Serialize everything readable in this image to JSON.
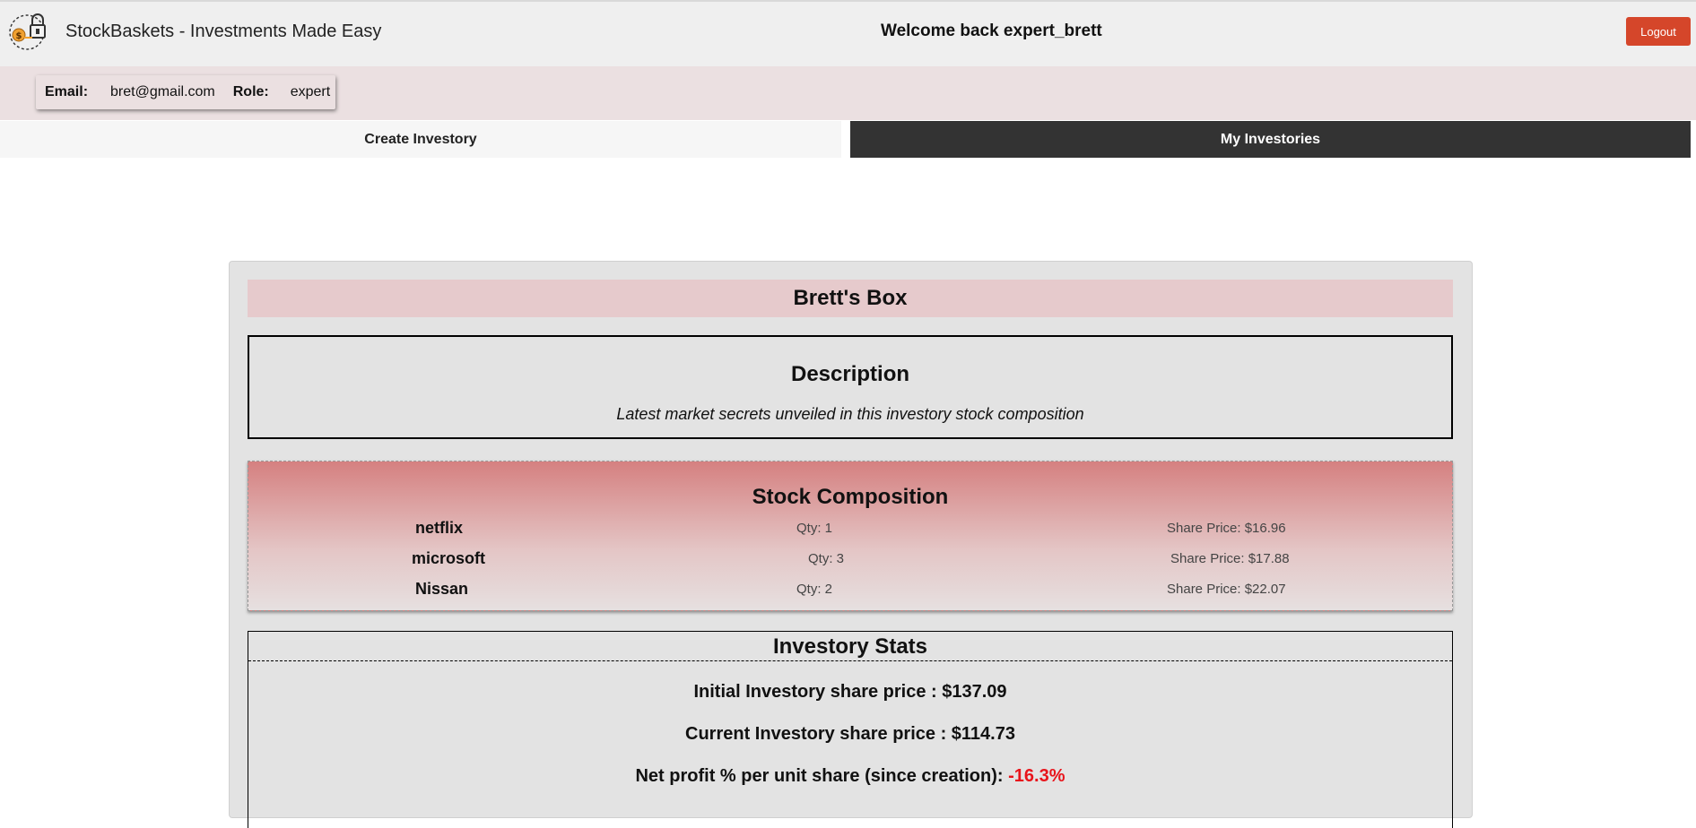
{
  "header": {
    "app_title": "StockBaskets - Investments Made Easy",
    "welcome": "Welcome back expert_brett",
    "logout_label": "Logout",
    "logo_icon": "lock-dollar-icon"
  },
  "user_info": {
    "email_label": "Email:",
    "email": "bret@gmail.com",
    "role_label": "Role:",
    "role": "expert"
  },
  "tabs": [
    {
      "label": "Create Investory",
      "active": false
    },
    {
      "label": "My Investories",
      "active": true
    }
  ],
  "investory": {
    "title": "Brett's Box",
    "description_heading": "Description",
    "description": "Latest market secrets unveiled in this investory stock composition",
    "composition_heading": "Stock Composition",
    "stocks": [
      {
        "name": "netflix",
        "qty": "Qty: 1",
        "price": "Share Price: $16.96"
      },
      {
        "name": "microsoft",
        "qty": "Qty: 3",
        "price": "Share Price: $17.88"
      },
      {
        "name": "Nissan",
        "qty": "Qty: 2",
        "price": "Share Price: $22.07"
      }
    ],
    "stats_heading": "Investory Stats",
    "initial_label": "Initial Investory share price : $137.09",
    "current_label": "Current Investory share price : $114.73",
    "profit_label": "Net profit % per unit share (since creation):",
    "profit_value": "-16.3%"
  },
  "colors": {
    "logout_bg": "#d5462a",
    "active_tab_bg": "#333333",
    "profit_negative": "#e8141b"
  }
}
